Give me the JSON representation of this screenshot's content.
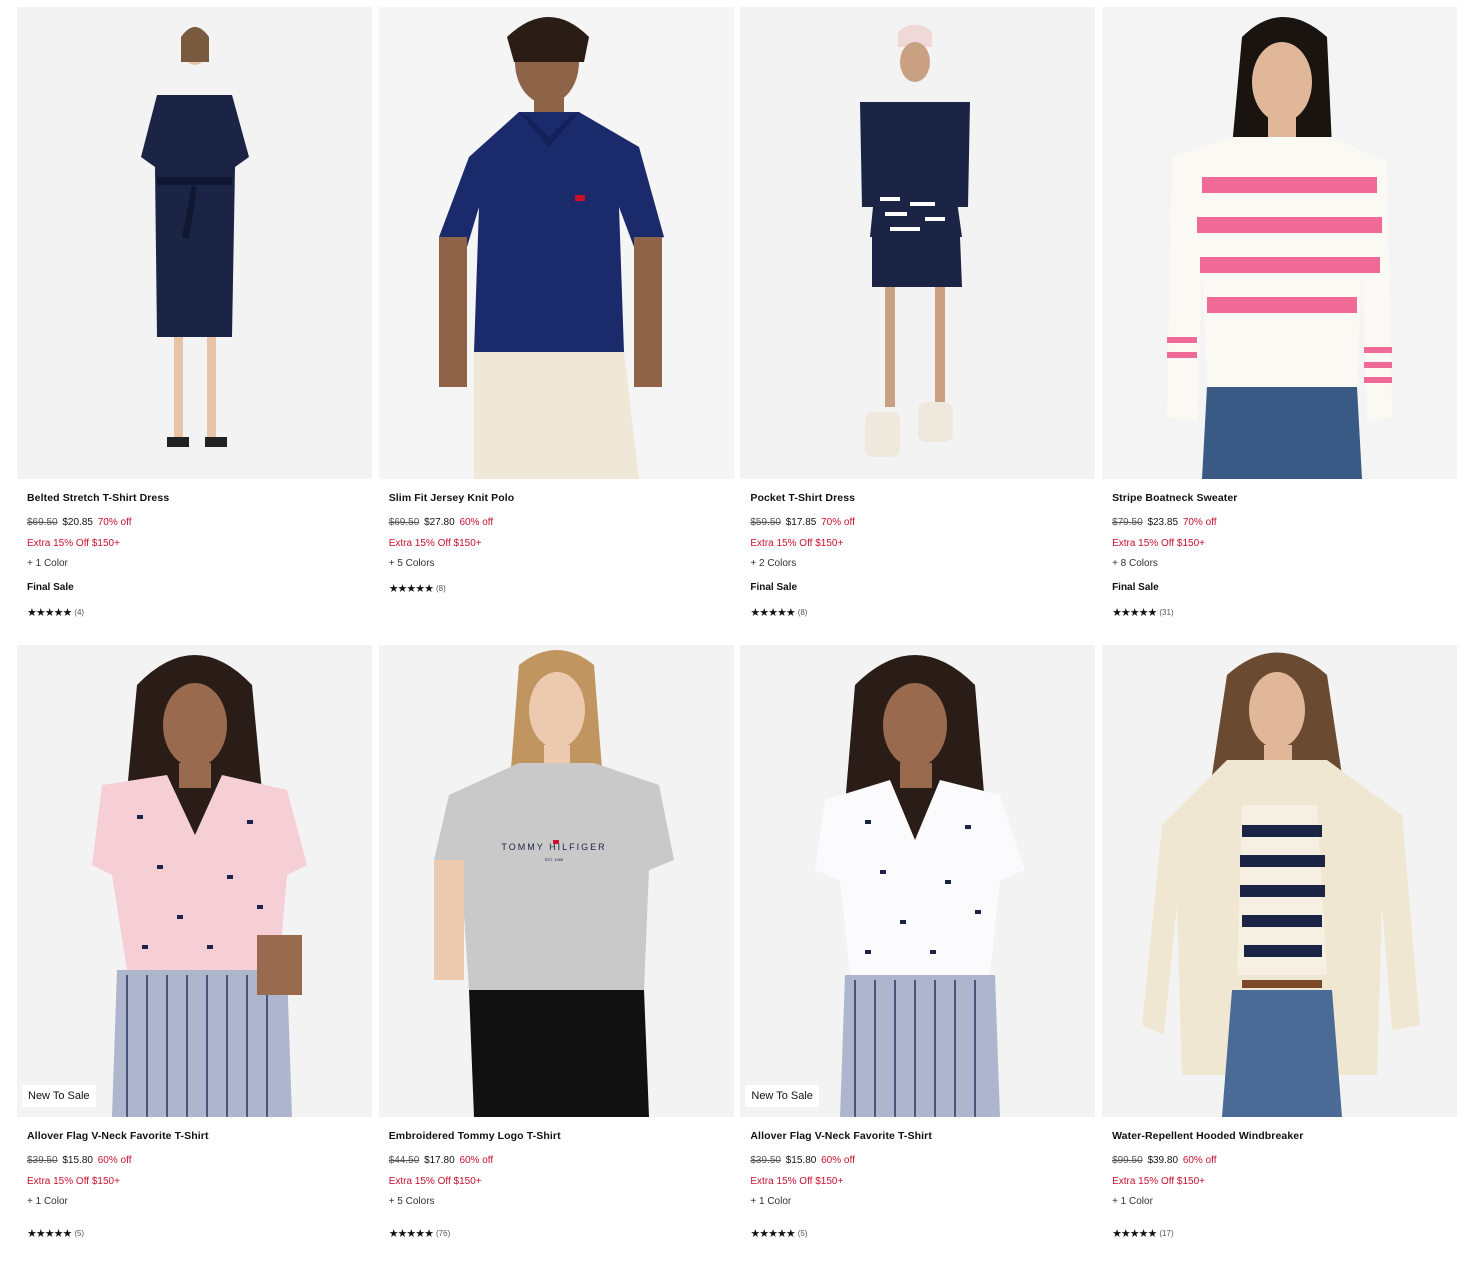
{
  "products": [
    {
      "title": "Belted Stretch T-Shirt Dress",
      "orig": "$69.50",
      "now": "$20.85",
      "pct": "70% off",
      "extra": "Extra 15% Off $150+",
      "colors": "+ 1 Color",
      "final": "Final Sale",
      "count": "(4)",
      "badge": "",
      "rating": 4.5
    },
    {
      "title": "Slim Fit Jersey Knit Polo",
      "orig": "$69.50",
      "now": "$27.80",
      "pct": "60% off",
      "extra": "Extra 15% Off $150+",
      "colors": "+ 5 Colors",
      "final": "",
      "count": "(8)",
      "badge": "",
      "rating": 4.5
    },
    {
      "title": "Pocket T-Shirt Dress",
      "orig": "$59.50",
      "now": "$17.85",
      "pct": "70% off",
      "extra": "Extra 15% Off $150+",
      "colors": "+ 2 Colors",
      "final": "Final Sale",
      "count": "(8)",
      "badge": "",
      "rating": 4.5
    },
    {
      "title": "Stripe Boatneck Sweater",
      "orig": "$79.50",
      "now": "$23.85",
      "pct": "70% off",
      "extra": "Extra 15% Off $150+",
      "colors": "+ 8 Colors",
      "final": "Final Sale",
      "count": "(31)",
      "badge": "",
      "rating": 4.5
    },
    {
      "title": "Allover Flag V-Neck Favorite T-Shirt",
      "orig": "$39.50",
      "now": "$15.80",
      "pct": "60% off",
      "extra": "Extra 15% Off $150+",
      "colors": "+ 1 Color",
      "final": "",
      "count": "(5)",
      "badge": "New To Sale",
      "rating": 4.5
    },
    {
      "title": "Embroidered Tommy Logo T-Shirt",
      "orig": "$44.50",
      "now": "$17.80",
      "pct": "60% off",
      "extra": "Extra 15% Off $150+",
      "colors": "+ 5 Colors",
      "final": "",
      "count": "(76)",
      "badge": "",
      "rating": 4.5
    },
    {
      "title": "Allover Flag V-Neck Favorite T-Shirt",
      "orig": "$39.50",
      "now": "$15.80",
      "pct": "60% off",
      "extra": "Extra 15% Off $150+",
      "colors": "+ 1 Color",
      "final": "",
      "count": "(5)",
      "badge": "New To Sale",
      "rating": 4.5
    },
    {
      "title": "Water-Repellent Hooded Windbreaker",
      "orig": "$99.50",
      "now": "$39.80",
      "pct": "60% off",
      "extra": "Extra 15% Off $150+",
      "colors": "+ 1 Color",
      "final": "",
      "count": "(17)",
      "badge": "",
      "rating": 4.5
    }
  ],
  "logo_text": "TOMMY HILFIGER",
  "logo_sub": "EST. 1985",
  "stars_glyph": "★★★★★",
  "colors": {
    "sale_red": "#c8102e",
    "navy": "#1b2444",
    "pink": "#f06a98",
    "sand": "#efe7d2",
    "grey_tee": "#c9c9c9",
    "light_pink": "#f6cfd6"
  }
}
